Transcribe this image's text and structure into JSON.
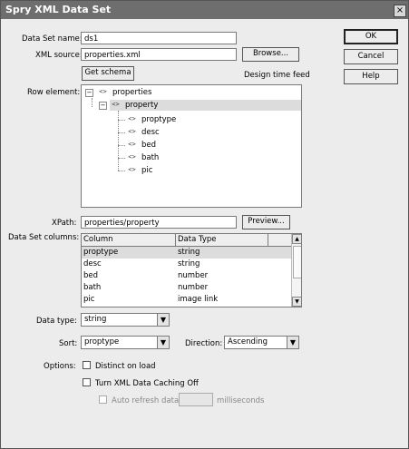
{
  "dialog": {
    "title": "Spry XML Data Set",
    "close_glyph": "×"
  },
  "buttons": {
    "ok": "OK",
    "cancel": "Cancel",
    "help": "Help",
    "browse": "Browse...",
    "preview": "Preview...",
    "get_schema": "Get schema"
  },
  "fields": {
    "data_set_name_label": "Data Set name:",
    "data_set_name_value": "ds1",
    "xml_source_label": "XML source:",
    "xml_source_value": "properties.xml",
    "design_time_feed": "Design time feed",
    "row_element_label": "Row element:",
    "xpath_label": "XPath:",
    "xpath_value": "properties/property",
    "data_set_columns_label": "Data Set columns:"
  },
  "tree": {
    "root": "properties",
    "child": "property",
    "leaves": [
      "proptype",
      "desc",
      "bed",
      "bath",
      "pic"
    ],
    "tag_glyph": "<>"
  },
  "columns_table": {
    "headers": [
      "Column",
      "Data Type"
    ],
    "rows": [
      [
        "proptype",
        "string"
      ],
      [
        "desc",
        "string"
      ],
      [
        "bed",
        "number"
      ],
      [
        "bath",
        "number"
      ],
      [
        "pic",
        "image link"
      ]
    ]
  },
  "options": {
    "data_type_label": "Data type:",
    "data_type_value": "string",
    "sort_label": "Sort:",
    "sort_value": "proptype",
    "direction_label": "Direction:",
    "direction_value": "Ascending",
    "options_label": "Options:",
    "distinct_on_load": "Distinct on load",
    "turn_off_caching": "Turn XML Data Caching Off",
    "auto_refresh": "Auto refresh data",
    "milliseconds": "milliseconds"
  },
  "glyphs": {
    "dropdown": "▼",
    "minus": "−",
    "scroll_up": "▲",
    "scroll_down": "▼"
  }
}
